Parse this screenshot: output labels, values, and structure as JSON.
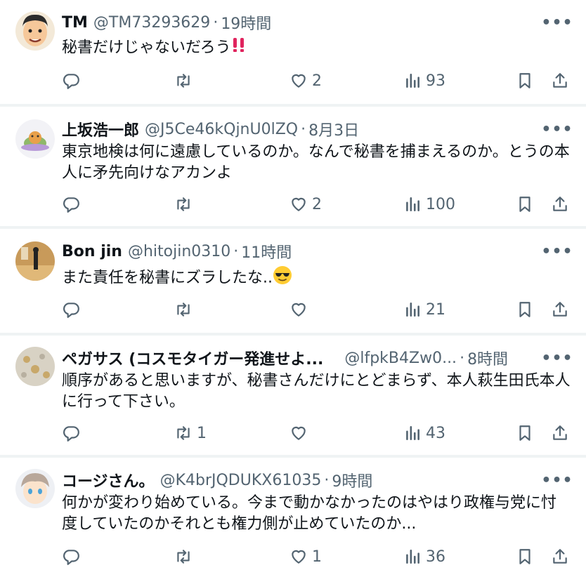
{
  "tweets": [
    {
      "name": "TM",
      "handle": "@TM73293629",
      "sep": "·",
      "time": "19時間",
      "text": "秘書だけじゃないだろう",
      "emoji": "double-exclamation",
      "replies": "",
      "retweets": "",
      "likes": "2",
      "views": "93"
    },
    {
      "name": "上坂浩一郎",
      "handle": "@J5Ce46kQjnU0lZQ",
      "sep": "·",
      "time": "8月3日",
      "text": "東京地検は何に遠慮しているのか。なんで秘書を捕まえるのか。とうの本人に矛先向けなアカンよ",
      "replies": "",
      "retweets": "",
      "likes": "2",
      "views": "100"
    },
    {
      "name": "Bon jin",
      "handle": "@hitojin0310",
      "sep": "·",
      "time": "11時間",
      "text": "また責任を秘書にズラしたな..",
      "emoji": "sunglasses-face",
      "replies": "",
      "retweets": "",
      "likes": "",
      "views": "21"
    },
    {
      "name": "ペガサス (コスモタイガー発進せよ...",
      "handle": "@lfpkB4Zw0...",
      "sep": "·",
      "time": "8時間",
      "text": "順序があると思いますが、秘書さんだけにとどまらず、本人萩生田氏本人に行って下さい。",
      "replies": "",
      "retweets": "1",
      "likes": "",
      "views": "43"
    },
    {
      "name": "コージさん。",
      "handle": "@K4brJQDUKX61035",
      "sep": "·",
      "time": "9時間",
      "text": "何かが変わり始めている。今まで動かなかったのはやはり政権与党に忖度していたのかそれとも権力側が止めていたのか...",
      "replies": "",
      "retweets": "",
      "likes": "1",
      "views": "36"
    }
  ],
  "icons": {
    "more": "more-icon",
    "reply": "reply-icon",
    "retweet": "retweet-icon",
    "like": "heart-icon",
    "views": "views-icon",
    "bookmark": "bookmark-icon",
    "share": "share-icon"
  },
  "colors": {
    "text": "#0f1419",
    "secondary": "#536471",
    "divider": "#eff3f4",
    "emoji_red": "#e0245e"
  }
}
